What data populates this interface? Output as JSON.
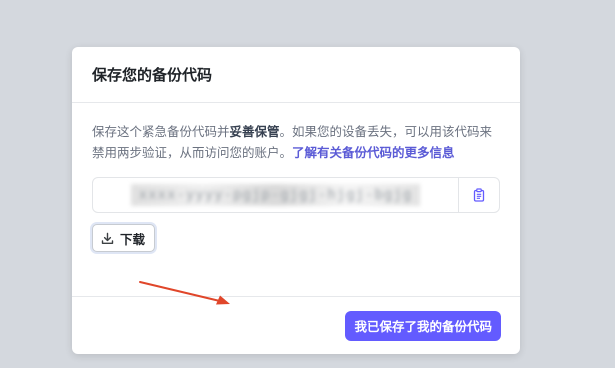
{
  "modal": {
    "title": "保存您的备份代码",
    "description": {
      "part1": "保存这个紧急备份代码并",
      "strong": "妥善保管",
      "part2": "。如果您的设备丢失，可以用该代码来禁用两步验证，从而访问您的账户。",
      "link": "了解有关备份代码的更多信息"
    },
    "backup_code": "xxxx-yyyy-pgjp-gjgj-hjgj-bgjg",
    "download_label": "下载",
    "confirm_label": "我已保存了我的备份代码"
  },
  "colors": {
    "background": "#d4d8de",
    "accent": "#635bff",
    "link": "#5b5bd6",
    "annotation_arrow": "#e0462a"
  },
  "icons": {
    "copy": "clipboard-icon",
    "download": "download-icon",
    "annotation": "red-arrow-icon"
  }
}
